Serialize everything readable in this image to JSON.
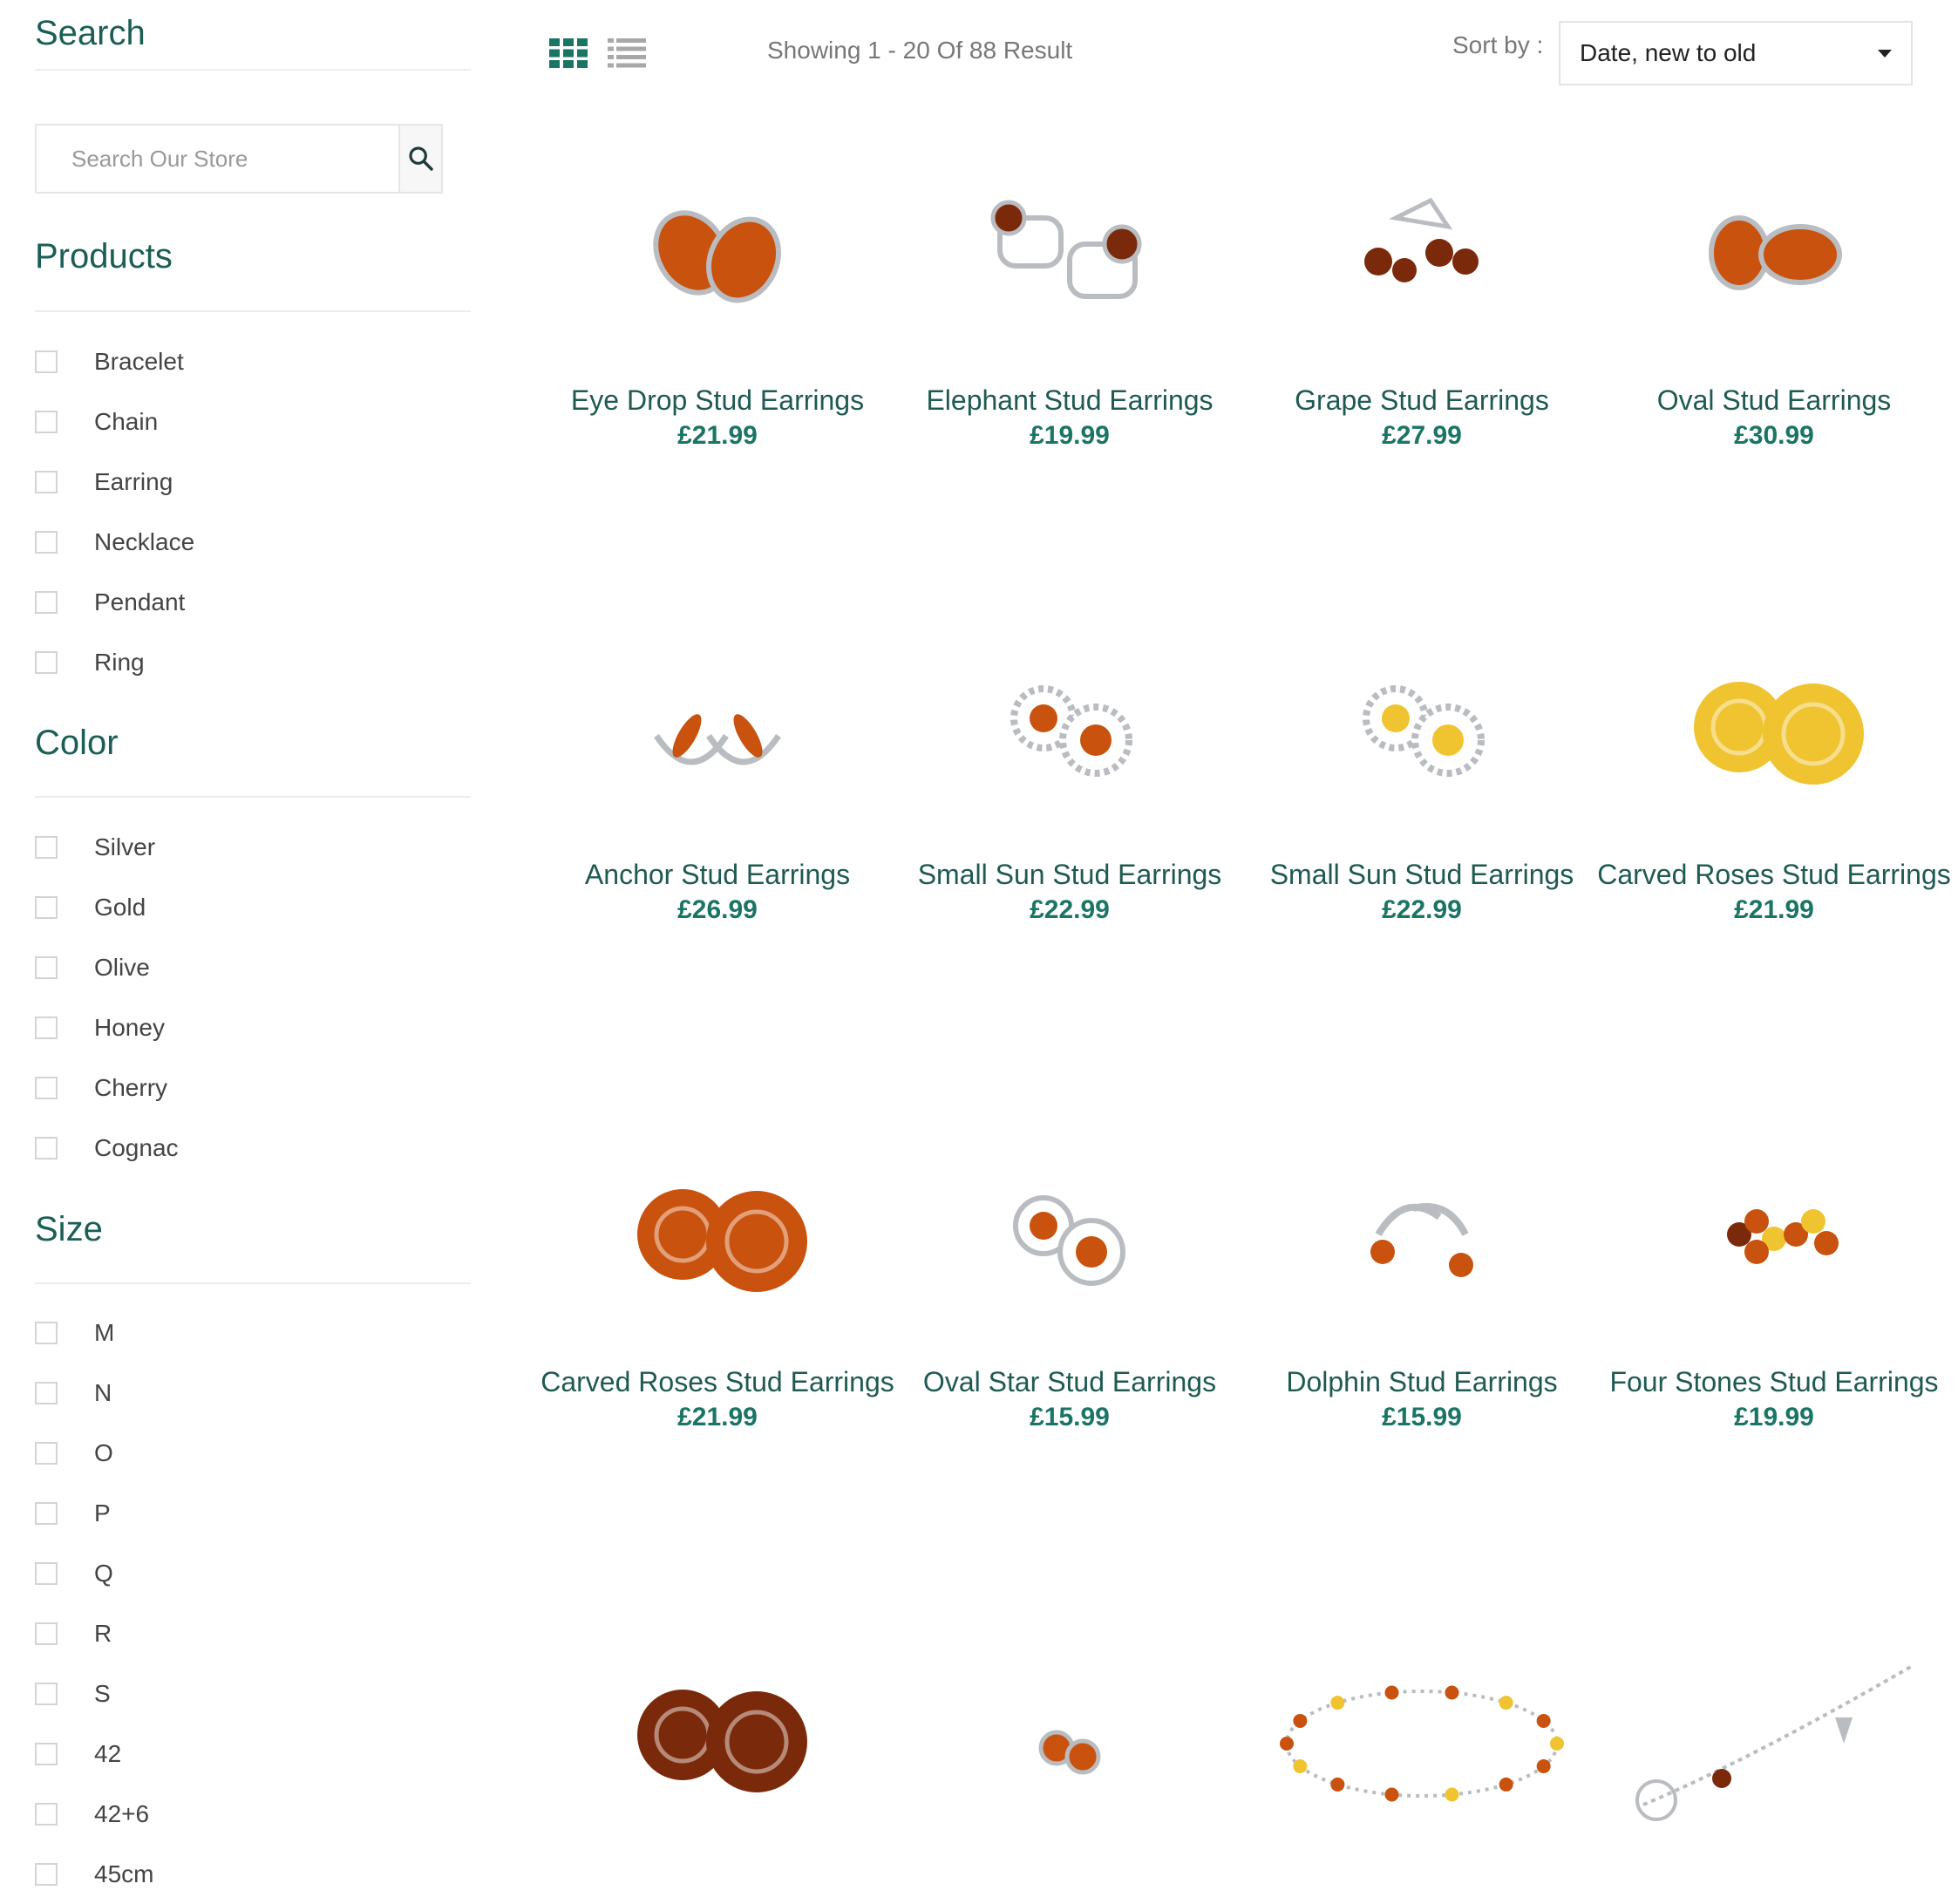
{
  "sidebar": {
    "search_title": "Search",
    "search_placeholder": "Search Our Store",
    "products_title": "Products",
    "products": [
      "Bracelet",
      "Chain",
      "Earring",
      "Necklace",
      "Pendant",
      "Ring"
    ],
    "color_title": "Color",
    "colors": [
      "Silver",
      "Gold",
      "Olive",
      "Honey",
      "Cherry",
      "Cognac"
    ],
    "size_title": "Size",
    "sizes": [
      "M",
      "N",
      "O",
      "P",
      "Q",
      "R",
      "S",
      "42",
      "42+6",
      "45cm"
    ]
  },
  "toolbar": {
    "result_text": "Showing 1 - 20 Of 88 Result",
    "sort_label": "Sort by :",
    "sort_value": "Date, new to old"
  },
  "theme": {
    "accent": "#1a5e55",
    "price": "#1a7565",
    "amber": "#c8520e",
    "honey": "#f0c430",
    "cherry": "#7a2a0a"
  },
  "products": [
    {
      "name": "Eye Drop Stud Earrings",
      "price": "£21.99",
      "icon": "teardrop-earrings",
      "stone": "amber"
    },
    {
      "name": "Elephant Stud Earrings",
      "price": "£19.99",
      "icon": "elephant-earrings",
      "stone": "cherry"
    },
    {
      "name": "Grape Stud Earrings",
      "price": "£27.99",
      "icon": "grape-earrings",
      "stone": "cherry"
    },
    {
      "name": "Oval Stud Earrings",
      "price": "£30.99",
      "icon": "oval-earrings",
      "stone": "amber"
    },
    {
      "name": "Anchor Stud Earrings",
      "price": "£26.99",
      "icon": "anchor-earrings",
      "stone": "amber"
    },
    {
      "name": "Small Sun Stud Earrings",
      "price": "£22.99",
      "icon": "sun-earrings",
      "stone": "amber"
    },
    {
      "name": "Small Sun Stud Earrings",
      "price": "£22.99",
      "icon": "sun-earrings",
      "stone": "honey"
    },
    {
      "name": "Carved Roses Stud Earrings",
      "price": "£21.99",
      "icon": "rose-earrings",
      "stone": "honey"
    },
    {
      "name": "Carved Roses Stud Earrings",
      "price": "£21.99",
      "icon": "rose-earrings",
      "stone": "amber"
    },
    {
      "name": "Oval Star Stud Earrings",
      "price": "£15.99",
      "icon": "star-earrings",
      "stone": "amber"
    },
    {
      "name": "Dolphin Stud Earrings",
      "price": "£15.99",
      "icon": "dolphin-earrings",
      "stone": "amber"
    },
    {
      "name": "Four Stones Stud Earrings",
      "price": "£19.99",
      "icon": "flower-earrings",
      "stone": "amber"
    },
    {
      "name": "",
      "price": "",
      "icon": "rose-earrings",
      "stone": "cherry"
    },
    {
      "name": "",
      "price": "",
      "icon": "small-earrings",
      "stone": "amber"
    },
    {
      "name": "",
      "price": "",
      "icon": "bracelet",
      "stone": "amber"
    },
    {
      "name": "",
      "price": "",
      "icon": "chain-bracelet",
      "stone": "cherry"
    }
  ]
}
